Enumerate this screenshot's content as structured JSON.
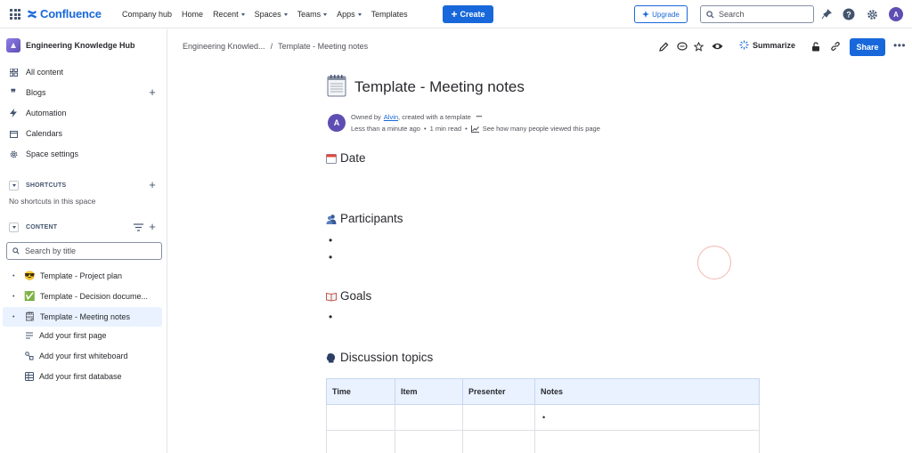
{
  "topbar": {
    "logo_text": "Confluence",
    "nav": [
      {
        "label": "Company hub",
        "dropdown": false
      },
      {
        "label": "Home",
        "dropdown": false
      },
      {
        "label": "Recent",
        "dropdown": true
      },
      {
        "label": "Spaces",
        "dropdown": true
      },
      {
        "label": "Teams",
        "dropdown": true
      },
      {
        "label": "Apps",
        "dropdown": true
      },
      {
        "label": "Templates",
        "dropdown": false
      }
    ],
    "create_label": "Create",
    "upgrade_label": "Upgrade",
    "search_placeholder": "Search",
    "avatar_initial": "A",
    "brand_color": "#1868db"
  },
  "sidebar": {
    "space_title": "Engineering Knowledge Hub",
    "items": [
      {
        "label": "All content",
        "icon": "grid-icon"
      },
      {
        "label": "Blogs",
        "icon": "quote-icon"
      },
      {
        "label": "Automation",
        "icon": "lightning-icon"
      },
      {
        "label": "Calendars",
        "icon": "calendar-icon"
      },
      {
        "label": "Space settings",
        "icon": "gear-icon"
      }
    ],
    "shortcuts_label": "SHORTCUTS",
    "shortcuts_empty": "No shortcuts in this space",
    "content_label": "CONTENT",
    "search_placeholder": "Search by title",
    "tree": [
      {
        "label": "Template - Project plan",
        "emoji": "😎",
        "active": false
      },
      {
        "label": "Template - Decision docume...",
        "emoji": "✅",
        "active": false
      },
      {
        "label": "Template - Meeting notes",
        "emoji": "🗒",
        "active": true
      }
    ],
    "add_items": [
      {
        "label": "Add your first page",
        "icon": "page-lines-icon"
      },
      {
        "label": "Add your first whiteboard",
        "icon": "whiteboard-icon"
      },
      {
        "label": "Add your first database",
        "icon": "database-icon"
      }
    ]
  },
  "breadcrumb": {
    "space": "Engineering Knowled...",
    "separator": "/",
    "page": "Template - Meeting notes"
  },
  "page_tools": {
    "summarize_label": "Summarize",
    "share_label": "Share"
  },
  "page": {
    "title": "Template - Meeting notes",
    "byline": {
      "avatar_initial": "A",
      "owned_by": "Owned by",
      "owner": "Alvin",
      "created": ", created with a template",
      "dots": "•••",
      "time": "Less than a minute ago",
      "sep": "•",
      "read_time": "1 min read",
      "views_link": "See how many people viewed this page"
    },
    "sections": {
      "date": "Date",
      "participants": "Participants",
      "goals": "Goals",
      "discussion": "Discussion topics"
    },
    "table": {
      "headers": [
        "Time",
        "Item",
        "Presenter",
        "Notes"
      ],
      "rows": [
        [
          "",
          "",
          "",
          "•"
        ],
        [
          "",
          "",
          "",
          ""
        ]
      ]
    }
  }
}
